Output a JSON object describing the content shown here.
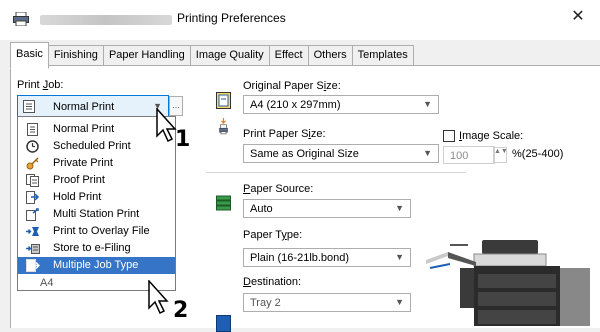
{
  "window": {
    "title": "Printing Preferences",
    "close_glyph": "✕"
  },
  "tabs": [
    "Basic",
    "Finishing",
    "Paper Handling",
    "Image Quality",
    "Effect",
    "Others",
    "Templates"
  ],
  "print_job": {
    "label_pre": "Print ",
    "label_ul": "J",
    "label_post": "ob:",
    "selected": "Normal Print",
    "dots": "...",
    "options": [
      {
        "label": "Normal Print",
        "icon": "document-icon"
      },
      {
        "label": "Scheduled Print",
        "icon": "clock-icon"
      },
      {
        "label": "Private Print",
        "icon": "key-icon"
      },
      {
        "label": "Proof Print",
        "icon": "proof-icon"
      },
      {
        "label": "Hold Print",
        "icon": "hold-icon"
      },
      {
        "label": "Multi Station Print",
        "icon": "multi-station-icon"
      },
      {
        "label": "Print to Overlay File",
        "icon": "overlay-icon"
      },
      {
        "label": "Store to e-Filing",
        "icon": "efiling-icon"
      },
      {
        "label": "Multiple Job Type",
        "icon": "multiple-job-icon"
      }
    ],
    "below_text": "A4"
  },
  "original_paper": {
    "label_pre": "Original Paper S",
    "label_ul": "i",
    "label_post": "ze:",
    "value": "A4 (210 x 297mm)"
  },
  "print_paper": {
    "label_pre": "Print Paper S",
    "label_ul": "i",
    "label_post": "ze:",
    "value": "Same as Original Size"
  },
  "image_scale": {
    "label_pre": "",
    "label_ul": "I",
    "label_post": "mage Scale:",
    "value": "100",
    "range": "%(25-400)",
    "spin": "▲▼"
  },
  "paper_source": {
    "label_pre": "",
    "label_ul": "P",
    "label_post": "aper Source:",
    "value": "Auto"
  },
  "paper_type": {
    "label_pre": "Paper T",
    "label_ul": "y",
    "label_post": "pe:",
    "value": "Plain (16-21lb.bond)"
  },
  "destination": {
    "label_pre": "",
    "label_ul": "D",
    "label_post": "estination:",
    "value": "Tray 2"
  },
  "callouts": {
    "step1": "1",
    "step2": "2"
  },
  "colors": {
    "accent": "#0078d7",
    "selected_bg": "#3574c6",
    "hover_bg": "#e5f1fb"
  }
}
